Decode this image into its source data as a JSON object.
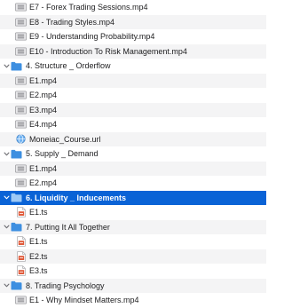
{
  "colors": {
    "folder": "#3d8fe0",
    "selection": "#0a63d6",
    "alt_row": "#f4f4f5"
  },
  "rows": [
    {
      "depth": 1,
      "kind": "video",
      "label": "E7 - Forex Trading Sessions.mp4"
    },
    {
      "depth": 1,
      "kind": "video",
      "label": "E8 - Trading Styles.mp4"
    },
    {
      "depth": 1,
      "kind": "video",
      "label": "E9 - Understanding Probability.mp4"
    },
    {
      "depth": 1,
      "kind": "video",
      "label": "E10 - Introduction To Risk Management.mp4"
    },
    {
      "depth": 0,
      "kind": "folder",
      "label": "4. Structure _ Orderflow"
    },
    {
      "depth": 1,
      "kind": "video",
      "label": "E1.mp4"
    },
    {
      "depth": 1,
      "kind": "video",
      "label": "E2.mp4"
    },
    {
      "depth": 1,
      "kind": "video",
      "label": "E3.mp4"
    },
    {
      "depth": 1,
      "kind": "video",
      "label": "E4.mp4"
    },
    {
      "depth": 1,
      "kind": "url",
      "label": "Moneiac_Course.url"
    },
    {
      "depth": 0,
      "kind": "folder",
      "label": "5. Supply _ Demand"
    },
    {
      "depth": 1,
      "kind": "video",
      "label": "E1.mp4"
    },
    {
      "depth": 1,
      "kind": "video",
      "label": "E2.mp4"
    },
    {
      "depth": 0,
      "kind": "folder",
      "label": "6. Liquidity _ Inducements",
      "selected": true
    },
    {
      "depth": 1,
      "kind": "ts",
      "label": "E1.ts"
    },
    {
      "depth": 0,
      "kind": "folder",
      "label": "7. Putting It All Together"
    },
    {
      "depth": 1,
      "kind": "ts",
      "label": "E1.ts"
    },
    {
      "depth": 1,
      "kind": "ts",
      "label": "E2.ts"
    },
    {
      "depth": 1,
      "kind": "ts",
      "label": "E3.ts"
    },
    {
      "depth": 0,
      "kind": "folder",
      "label": "8. Trading Psychology"
    },
    {
      "depth": 1,
      "kind": "video",
      "label": "E1 - Why Mindset Matters.mp4"
    }
  ]
}
